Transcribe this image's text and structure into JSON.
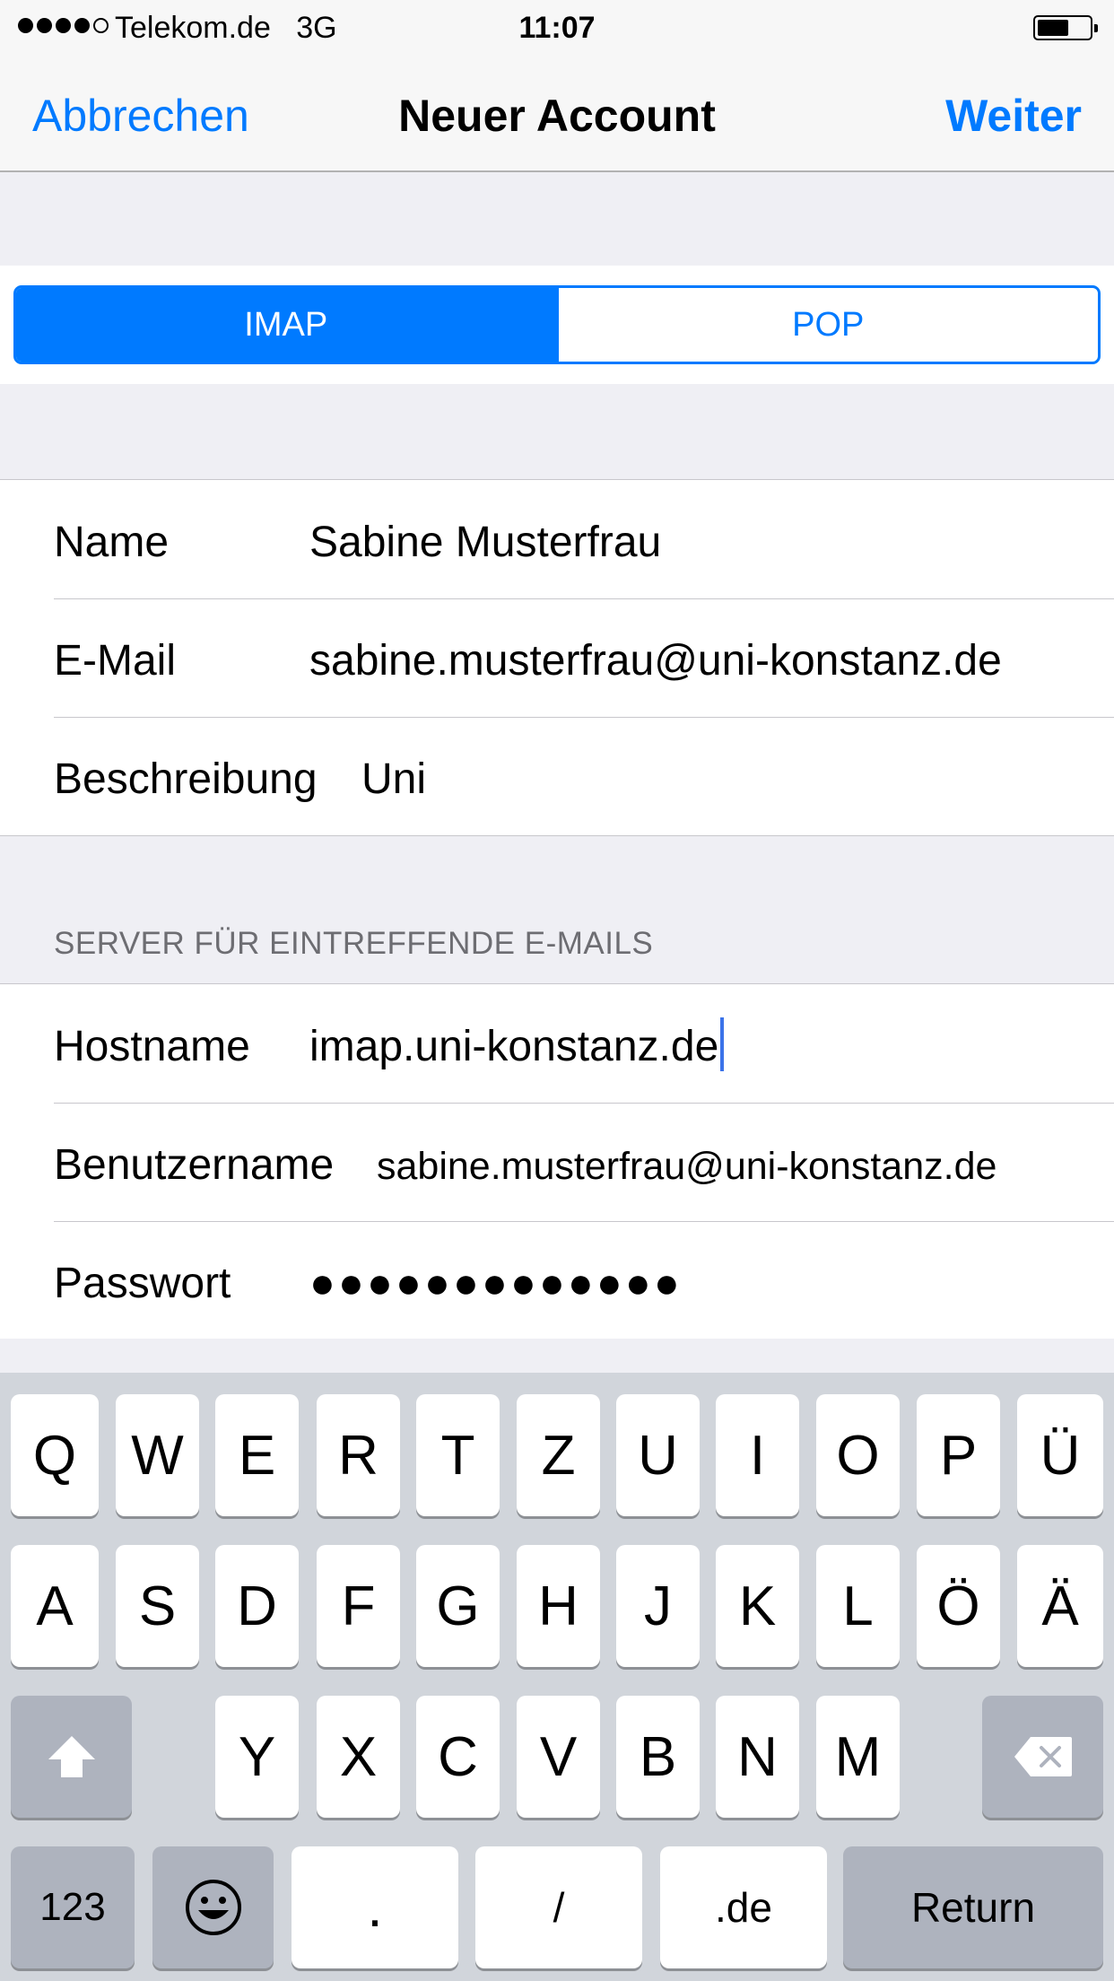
{
  "status_bar": {
    "signal_filled": 4,
    "signal_total": 5,
    "carrier": "Telekom.de",
    "network": "3G",
    "time": "11:07",
    "battery_level": 0.6
  },
  "nav": {
    "cancel_label": "Abbrechen",
    "title": "Neuer Account",
    "next_label": "Weiter"
  },
  "segmented": {
    "options": [
      "IMAP",
      "POP"
    ],
    "selected": "IMAP"
  },
  "account": {
    "name_label": "Name",
    "name_value": "Sabine Musterfrau",
    "email_label": "E-Mail",
    "email_value": "sabine.musterfrau@uni-konstanz.de",
    "description_label": "Beschreibung",
    "description_value": "Uni"
  },
  "incoming_server": {
    "header": "SERVER FÜR EINTREFFENDE E-MAILS",
    "hostname_label": "Hostname",
    "hostname_value": "imap.uni-konstanz.de",
    "username_label": "Benutzername",
    "username_value": "sabine.musterfrau@uni-konstanz.de",
    "password_label": "Passwort",
    "password_value": "●●●●●●●●●●●●●"
  },
  "keyboard": {
    "row1": [
      "Q",
      "W",
      "E",
      "R",
      "T",
      "Z",
      "U",
      "I",
      "O",
      "P",
      "Ü"
    ],
    "row2": [
      "A",
      "S",
      "D",
      "F",
      "G",
      "H",
      "J",
      "K",
      "L",
      "Ö",
      "Ä"
    ],
    "row3": [
      "Y",
      "X",
      "C",
      "V",
      "B",
      "N",
      "M"
    ],
    "numbers_label": "123",
    "emoji_label": "☺",
    "period_label": ".",
    "slash_label": "/",
    "tld_label": ".de",
    "return_label": "Return",
    "shift_icon": "shift-arrow-icon",
    "delete_icon": "backspace-icon"
  },
  "colors": {
    "accent": "#007aff",
    "background": "#efeff4",
    "keyboard_bg": "#d1d5db",
    "caret": "#3b73e9"
  }
}
